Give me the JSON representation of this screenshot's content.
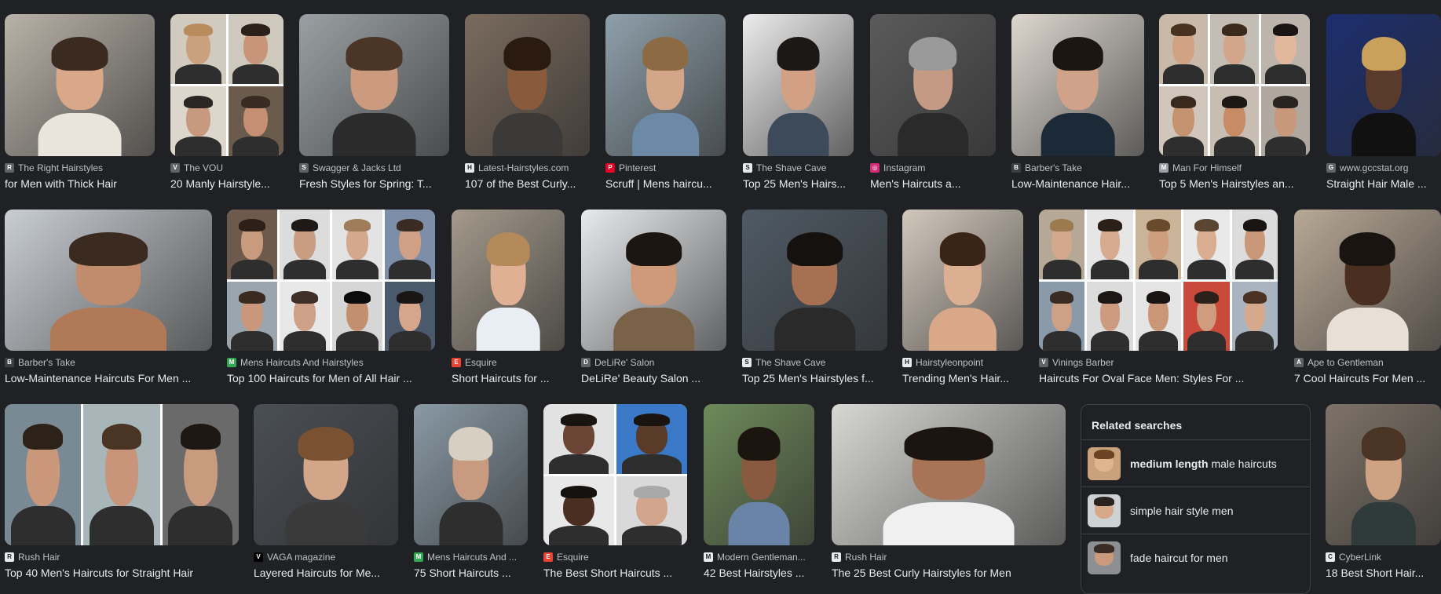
{
  "results": [
    {
      "source": "The Right Hairstyles",
      "title": "for Men with Thick Hair",
      "icon": "right-hairstyles-icon",
      "favColor": "#5f6368",
      "favGlyph": "R"
    },
    {
      "source": "The VOU",
      "title": "20 Manly Hairstyle...",
      "icon": "vou-icon",
      "favColor": "#5f6368",
      "favGlyph": "V"
    },
    {
      "source": "Swagger & Jacks Ltd",
      "title": "Fresh Styles for Spring: T...",
      "icon": "swagger-icon",
      "favColor": "#5f6368",
      "favGlyph": "S"
    },
    {
      "source": "Latest-Hairstyles.com",
      "title": "107 of the Best Curly...",
      "icon": "latest-hairstyles-icon",
      "favColor": "#e8eaed",
      "favGlyph": "H"
    },
    {
      "source": "Pinterest",
      "title": "Scruff | Mens haircu...",
      "icon": "pinterest-icon",
      "favColor": "#e60023",
      "favGlyph": "P"
    },
    {
      "source": "The Shave Cave",
      "title": "Top 25 Men's Hairs...",
      "icon": "shave-cave-icon",
      "favColor": "#e8eaed",
      "favGlyph": "S"
    },
    {
      "source": "Instagram",
      "title": "Men's Haircuts a...",
      "icon": "instagram-icon",
      "favColor": "#d62976",
      "favGlyph": "◎"
    },
    {
      "source": "Barber's Take",
      "title": "Low-Maintenance Hair...",
      "icon": "barbers-take-icon",
      "favColor": "#3c4043",
      "favGlyph": "B"
    },
    {
      "source": "Man For Himself",
      "title": "Top 5 Men's Hairstyles an...",
      "icon": "man-for-himself-icon",
      "favColor": "#9aa0a6",
      "favGlyph": "M"
    },
    {
      "source": "www.gccstat.org",
      "title": "Straight Hair Male ...",
      "icon": "gccstat-icon",
      "favColor": "#5f6368",
      "favGlyph": "G"
    },
    {
      "source": "Barber's Take",
      "title": "Low-Maintenance Haircuts For Men ...",
      "icon": "barbers-take-icon",
      "favColor": "#3c4043",
      "favGlyph": "B"
    },
    {
      "source": "Mens Haircuts And Hairstyles",
      "title": "Top 100 Haircuts for Men of All Hair ...",
      "icon": "mens-haircuts-icon",
      "favColor": "#34a853",
      "favGlyph": "M"
    },
    {
      "source": "Esquire",
      "title": "Short Haircuts for ...",
      "icon": "esquire-icon",
      "favColor": "#ea4335",
      "favGlyph": "E"
    },
    {
      "source": "DeLiRe' Salon",
      "title": "DeLiRe' Beauty Salon ...",
      "icon": "delire-salon-icon",
      "favColor": "#5f6368",
      "favGlyph": "D"
    },
    {
      "source": "The Shave Cave",
      "title": "Top 25 Men's Hairstyles f...",
      "icon": "shave-cave-icon",
      "favColor": "#e8eaed",
      "favGlyph": "S"
    },
    {
      "source": "Hairstyleonpoint",
      "title": "Trending Men's Hair...",
      "icon": "hairstyleonpoint-icon",
      "favColor": "#e8eaed",
      "favGlyph": "H"
    },
    {
      "source": "Vinings Barber",
      "title": "Haircuts For Oval Face Men: Styles For ...",
      "icon": "vinings-barber-icon",
      "favColor": "#5f6368",
      "favGlyph": "V"
    },
    {
      "source": "Ape to Gentleman",
      "title": "7 Cool Haircuts For Men ...",
      "icon": "ape-to-gentleman-icon",
      "favColor": "#5f6368",
      "favGlyph": "A"
    },
    {
      "source": "Rush Hair",
      "title": "Top 40 Men's Haircuts for Straight Hair",
      "icon": "rush-hair-icon",
      "favColor": "#e8eaed",
      "favGlyph": "R"
    },
    {
      "source": "VAGA magazine",
      "title": "Layered Haircuts for Me...",
      "icon": "vaga-magazine-icon",
      "favColor": "#000000",
      "favGlyph": "V"
    },
    {
      "source": "Mens Haircuts And ...",
      "title": "75 Short Haircuts ...",
      "icon": "mens-haircuts-icon",
      "favColor": "#34a853",
      "favGlyph": "M"
    },
    {
      "source": "Esquire",
      "title": "The Best Short Haircuts ...",
      "icon": "esquire-icon",
      "favColor": "#ea4335",
      "favGlyph": "E"
    },
    {
      "source": "Modern Gentleman...",
      "title": "42 Best Hairstyles ...",
      "icon": "modern-gentleman-icon",
      "favColor": "#e8eaed",
      "favGlyph": "M"
    },
    {
      "source": "Rush Hair",
      "title": "The 25 Best Curly Hairstyles for Men",
      "icon": "rush-hair-icon",
      "favColor": "#e8eaed",
      "favGlyph": "R"
    },
    {
      "source": "CyberLink",
      "title": "18 Best Short Hair...",
      "icon": "cyberlink-icon",
      "favColor": "#e8eaed",
      "favGlyph": "C"
    }
  ],
  "related": {
    "title": "Related searches",
    "items": [
      {
        "bold": "medium length",
        "rest": " male haircuts"
      },
      {
        "bold": "",
        "rest": "simple hair style men"
      },
      {
        "bold": "",
        "rest": "fade haircut for men"
      }
    ]
  }
}
